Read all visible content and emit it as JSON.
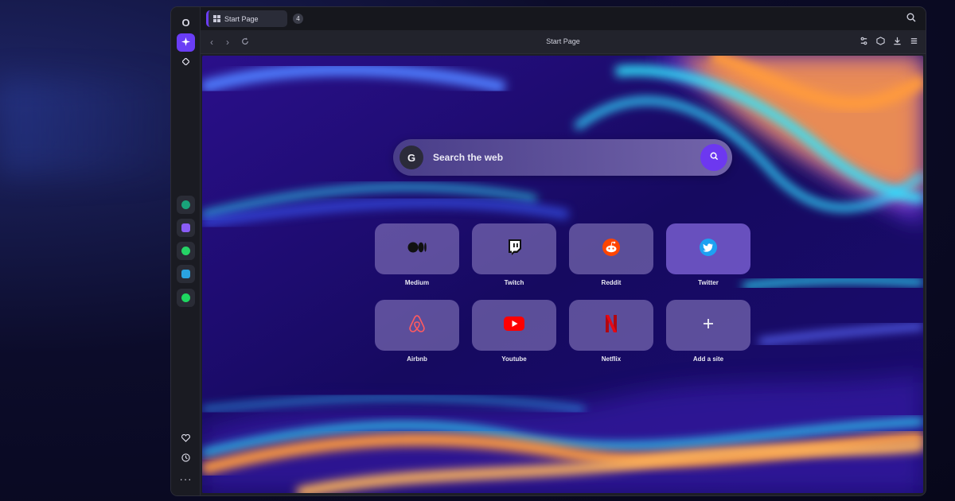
{
  "browser": {
    "tab": {
      "label": "Start Page",
      "count": "4"
    },
    "address": "Start Page"
  },
  "sidebar": {
    "logo": "O",
    "apps": [
      {
        "name": "chatgpt-icon",
        "color": "#19a37a"
      },
      {
        "name": "messenger-icon",
        "color": "#8a5cf6"
      },
      {
        "name": "whatsapp-icon",
        "color": "#25d366"
      },
      {
        "name": "telegram-icon",
        "color": "#2aa3e0"
      },
      {
        "name": "spotify-icon",
        "color": "#1ed760"
      }
    ],
    "more": "···"
  },
  "search": {
    "provider_letter": "G",
    "placeholder": "Search the web"
  },
  "speed_dials": [
    {
      "label": "Medium",
      "icon": "medium-icon"
    },
    {
      "label": "Twitch",
      "icon": "twitch-icon"
    },
    {
      "label": "Reddit",
      "icon": "reddit-icon"
    },
    {
      "label": "Twitter",
      "icon": "twitter-icon"
    },
    {
      "label": "Airbnb",
      "icon": "airbnb-icon"
    },
    {
      "label": "Youtube",
      "icon": "youtube-icon"
    },
    {
      "label": "Netflix",
      "icon": "netflix-icon"
    },
    {
      "label": "Add a site",
      "icon": "plus-icon"
    }
  ],
  "colors": {
    "accent": "#6a3df5",
    "wallpaper_base": "#180a6a",
    "wave_cyan": "#2ee6ff",
    "wave_orange": "#ff9a3c"
  }
}
